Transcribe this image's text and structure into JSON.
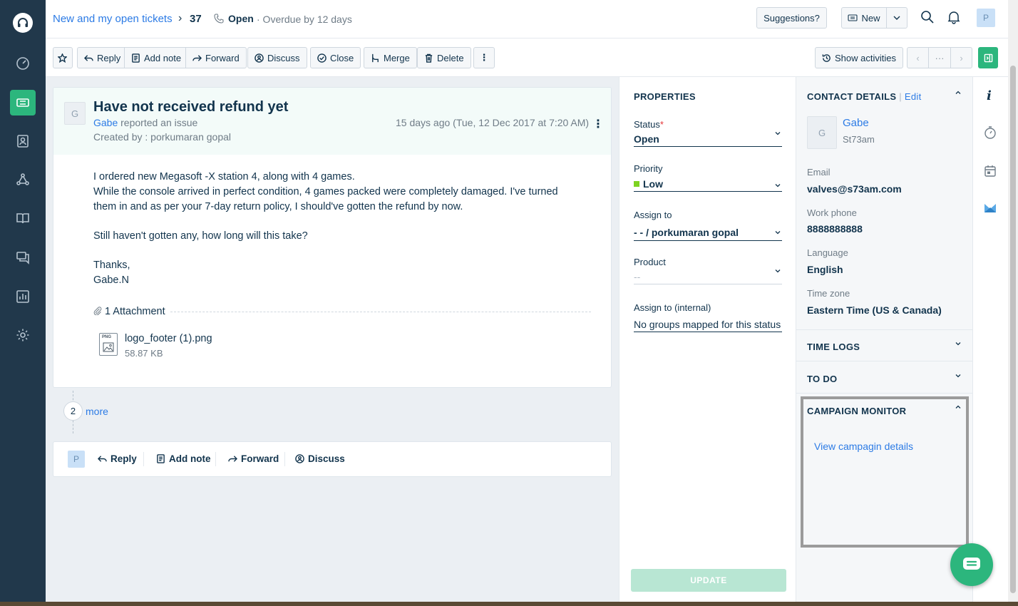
{
  "header": {
    "breadcrumb": "New and my open tickets",
    "ticket_number": "37",
    "status": "Open",
    "overdue": "· Overdue by 12 days",
    "suggestions_label": "Suggestions?",
    "new_label": "New",
    "user_initial": "P"
  },
  "toolbar": {
    "reply": "Reply",
    "add_note": "Add note",
    "forward": "Forward",
    "discuss": "Discuss",
    "close": "Close",
    "merge": "Merge",
    "delete": "Delete",
    "show_activities": "Show activities",
    "ellipsis": "···"
  },
  "ticket": {
    "requester_initial": "G",
    "subject": "Have not received refund yet",
    "requester": "Gabe",
    "reported_text": " reported an issue",
    "created_by": "Created by : porkumaran gopal",
    "timestamp": "15 days ago (Tue, 12 Dec 2017 at 7:20 AM)",
    "body": [
      "I ordered new Megasoft -X station 4, along with 4 games.",
      "While the console arrived in perfect condition, 4 games packed were completely damaged. I've turned",
      "them in and as per your 7-day return policy, I should've gotten the refund by now.",
      "Still haven't gotten any, how long will this take?",
      "Thanks,",
      "Gabe.N"
    ],
    "attachment_count": "1 Attachment",
    "attachment_name": "logo_footer (1).png",
    "attachment_size": "58.87 KB",
    "file_type": "PNG"
  },
  "more": {
    "count": "2",
    "label": "more"
  },
  "reply_bar": {
    "user_initial": "P",
    "reply": "Reply",
    "add_note": "Add note",
    "forward": "Forward",
    "discuss": "Discuss"
  },
  "properties": {
    "title": "PROPERTIES",
    "status_label": "Status",
    "required_mark": "*",
    "status_value": "Open",
    "priority_label": "Priority",
    "priority_value": "Low",
    "priority_color": "#7ed321",
    "assign_label": "Assign to",
    "assign_value": "- - / porkumaran gopal",
    "product_label": "Product",
    "product_value": "--",
    "assign_internal_label": "Assign to (internal)",
    "assign_internal_value": "No groups mapped for this status",
    "update_label": "UPDATE"
  },
  "contact": {
    "title": "CONTACT DETAILS",
    "separator": "|",
    "edit": "Edit",
    "initial": "G",
    "name": "Gabe",
    "handle": "St73am",
    "email_label": "Email",
    "email": "valves@s73am.com",
    "phone_label": "Work phone",
    "phone": "8888888888",
    "language_label": "Language",
    "language": "English",
    "timezone_label": "Time zone",
    "timezone": "Eastern Time (US & Canada)",
    "time_logs": "TIME LOGS",
    "todo": "TO DO",
    "campaign_title": "CAMPAIGN MONITOR",
    "campaign_link": "View campagin details"
  },
  "rail": {
    "info_icon": "i"
  },
  "colors": {
    "accent": "#2cb67d",
    "link": "#2c7be5",
    "sidebar": "#21384b"
  }
}
